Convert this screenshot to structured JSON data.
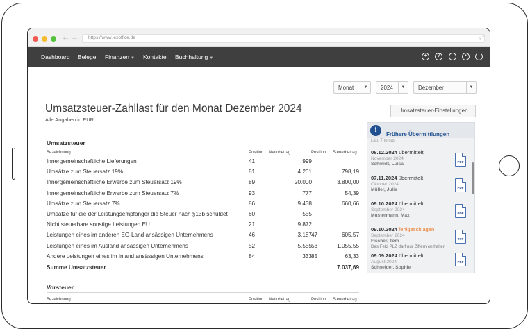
{
  "browser": {
    "url": "https://www.lexoffice.de"
  },
  "topnav": {
    "items": [
      "Dashboard",
      "Belege",
      "Finanzen",
      "Kontakte",
      "Buchhaltung"
    ],
    "icons": [
      "plus-circle-icon",
      "help-icon",
      "search-icon",
      "gear-icon",
      "power-icon"
    ]
  },
  "filters": {
    "period_type": "Monat",
    "year": "2024",
    "month": "Dezember"
  },
  "page": {
    "title": "Umsatzsteuer-Zahllast für den Monat Dezember 2024",
    "subtitle": "Alle Angaben in EUR",
    "settings_button": "Umsatzsteuer-Einstellungen"
  },
  "columns": {
    "description": "Bezeichnung",
    "position": "Position",
    "net_amount": "Nettobetrag",
    "tax_amount": "Steuerbetrag"
  },
  "vat_section": {
    "title": "Umsatzsteuer",
    "rows": [
      {
        "label": "Innergemeinschaftliche Lieferungen",
        "pos1": "41",
        "net": "999",
        "pos2": "",
        "tax": ""
      },
      {
        "label": "Umsätze zum Steuersatz 19%",
        "pos1": "81",
        "net": "4.201",
        "pos2": "",
        "tax": "798,19"
      },
      {
        "label": "Innergemeinschaftliche Erwerbe zum Steuersatz 19%",
        "pos1": "89",
        "net": "20.000",
        "pos2": "",
        "tax": "3.800,00"
      },
      {
        "label": "Innergemeinschaftliche Erwerbe zum Steuersatz 7%",
        "pos1": "93",
        "net": "777",
        "pos2": "",
        "tax": "54,39"
      },
      {
        "label": "Umsätze zum Steuersatz 7%",
        "pos1": "86",
        "net": "9.438",
        "pos2": "",
        "tax": "660,66"
      },
      {
        "label": "Umsätze für die der Leistungsempfänger die Steuer nach §13b schuldet",
        "pos1": "60",
        "net": "555",
        "pos2": "",
        "tax": ""
      },
      {
        "label": "Nicht steuerbare sonstige Leistungen EU",
        "pos1": "21",
        "net": "9.872",
        "pos2": "",
        "tax": ""
      },
      {
        "label": "Leistungen eines im anderen EG-Land ansässigen Unternehmens",
        "pos1": "46",
        "net": "3.187",
        "pos2": "47",
        "tax": "605,57"
      },
      {
        "label": "Leistungen eines im Ausland ansässigen Unternehmens",
        "pos1": "52",
        "net": "5.555",
        "pos2": "53",
        "tax": "1.055,55"
      },
      {
        "label": "Andere Leistungen eines im Inland ansässigen Unternehmens",
        "pos1": "84",
        "net": "333",
        "pos2": "85",
        "tax": "63,33"
      }
    ],
    "total_label": "Summe Umsatzsteuer",
    "total_value": "7.037,69"
  },
  "input_tax_section": {
    "title": "Vorsteuer"
  },
  "submissions": {
    "title": "Frühere Übermittlungen",
    "ghost_text": "Läb, Thomas",
    "items": [
      {
        "date": "08.12.2024",
        "status": "übermittelt",
        "period": "November 2024",
        "person": "Schmidt, Luisa",
        "file": "PDF",
        "error": "",
        "failed": false
      },
      {
        "date": "07.11.2024",
        "status": "übermittelt",
        "period": "Oktober 2024",
        "person": "Müller, Julia",
        "file": "PDF",
        "error": "",
        "failed": false
      },
      {
        "date": "09.10.2024",
        "status": "übermittelt",
        "period": "September 2024",
        "person": "Mustermann, Max",
        "file": "PDF",
        "error": "",
        "failed": false
      },
      {
        "date": "09.10.2024",
        "status": "fehlgeschlagen",
        "period": "September 2024",
        "person": "Fischer, Tom",
        "file": "TXT",
        "error": "Das Feld PLZ darf nur Ziffern enthalten",
        "failed": true
      },
      {
        "date": "09.09.2024",
        "status": "übermittelt",
        "period": "August 2024",
        "person": "Schneider, Sophie",
        "file": "PDF",
        "error": "",
        "failed": false
      }
    ]
  },
  "colors": {
    "nav_bg": "#3f3f3f",
    "accent_blue": "#1f4f8f",
    "failed_orange": "#e97a2a"
  }
}
